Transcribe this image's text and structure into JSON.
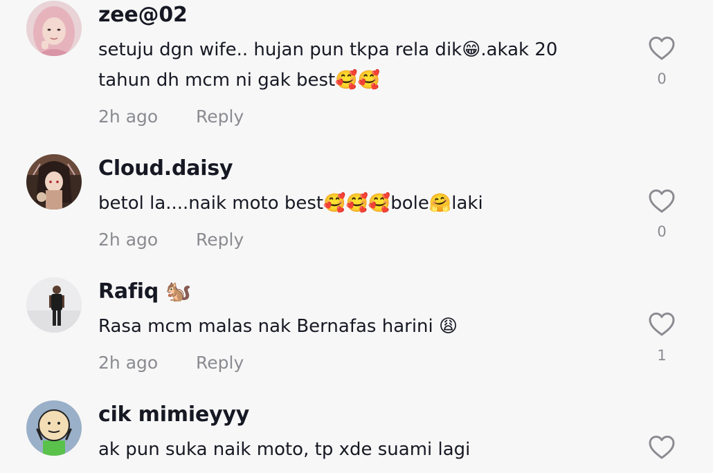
{
  "comments": [
    {
      "username": "zee@02",
      "text_line1": "setuju dgn wife.. hujan pun tkpa rela dik😁.akak 20",
      "text_line2": "tahun dh mcm ni gak best🥰🥰",
      "time": "2h ago",
      "reply_label": "Reply",
      "likes": "0",
      "avatar": "profile-photo-woman-hijab"
    },
    {
      "username": "Cloud.daisy",
      "text_line1": "betol la....naik moto best🥰🥰🥰bole🤗laki",
      "time": "2h ago",
      "reply_label": "Reply",
      "likes": "0",
      "avatar": "profile-illustration-anime"
    },
    {
      "username": "Rafiq 🐿️",
      "text_line1": "Rasa mcm malas nak Bernafas harini 😩",
      "time": "2h ago",
      "reply_label": "Reply",
      "likes": "1",
      "avatar": "profile-photo-man-standing"
    },
    {
      "username": "cik mimieyyy",
      "text_line1": "ak pun suka naik moto, tp xde suami lagi",
      "avatar": "profile-cartoon-character"
    }
  ],
  "colors": {
    "background": "#f7f7f7",
    "primary_text": "#161823",
    "secondary_text": "#8a8b91",
    "heart_outline": "#8a8b91"
  },
  "icons": {
    "like": "heart-outline-icon"
  }
}
